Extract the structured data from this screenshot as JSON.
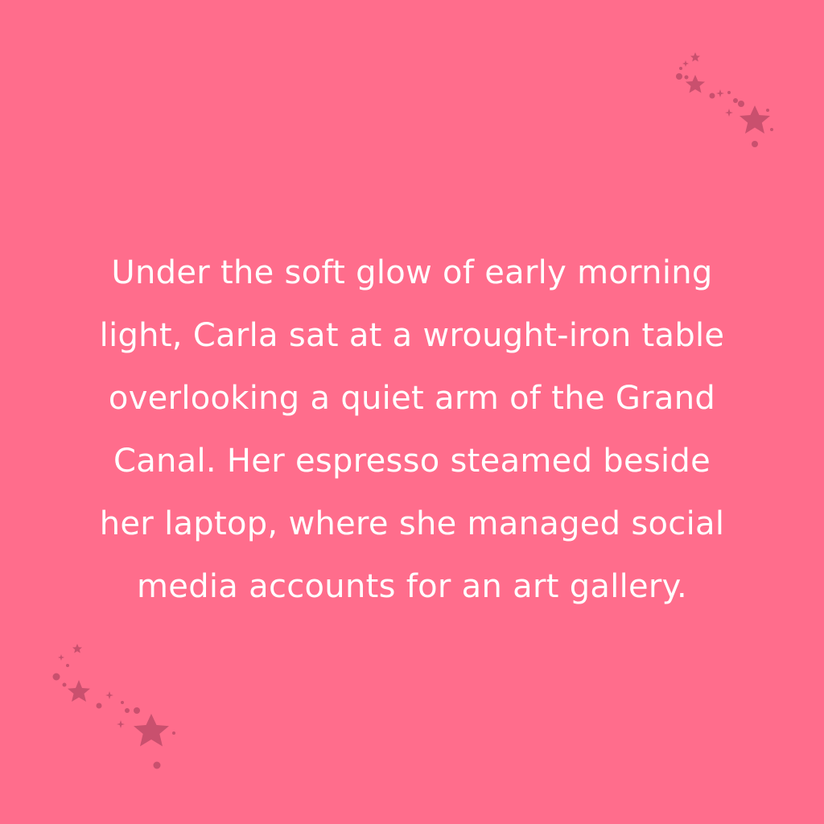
{
  "background_color": "#ff6d8c",
  "decoration_color": "#c9506e",
  "text_color": "#ffffff",
  "story": {
    "lines": [
      "Under the soft glow of early morning",
      "light, Carla sat at a wrought-iron table",
      "overlooking a quiet arm of the Grand",
      "Canal. Her espresso steamed beside",
      "her laptop, where she managed social",
      "media accounts for an art gallery."
    ]
  },
  "decorations": {
    "top_right": "shooting-stars-icon",
    "bottom_left": "shooting-stars-icon"
  }
}
